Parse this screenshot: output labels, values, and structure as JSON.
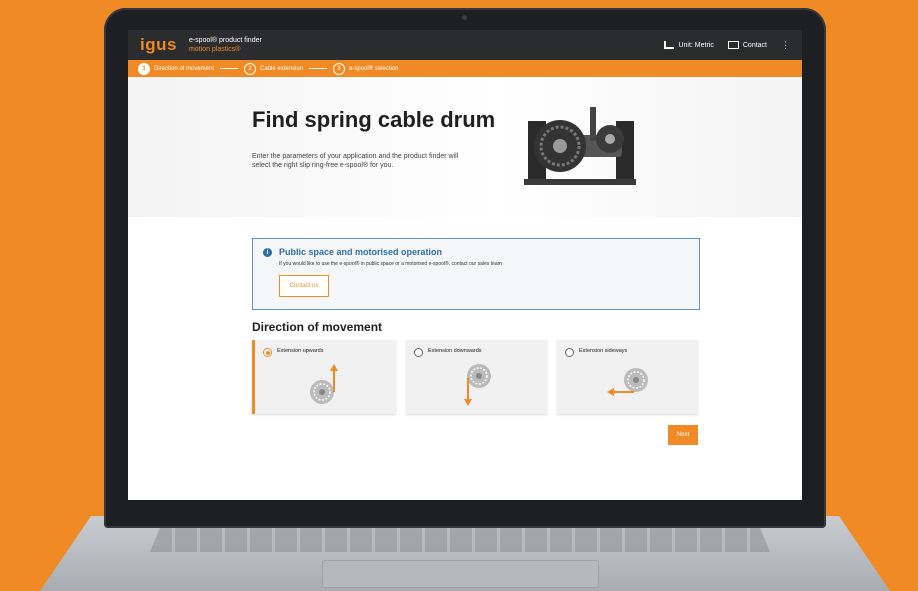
{
  "app": {
    "logo": "igus",
    "title": "e-spool® product finder",
    "subtitle": "motion plastics®"
  },
  "header": {
    "unit_label": "Unit: Metric",
    "contact_label": "Contact",
    "menu_icon": "more-vertical-icon"
  },
  "steps": [
    {
      "number": "1",
      "label": "Direction of movement",
      "active": true
    },
    {
      "number": "2",
      "label": "Cable extension",
      "active": false
    },
    {
      "number": "3",
      "label": "e-spool® selection",
      "active": false
    }
  ],
  "hero": {
    "title": "Find spring cable drum",
    "description": "Enter the parameters of your application and the product finder will select the right slip ring-free e-spool® for you."
  },
  "info": {
    "title": "Public space and motorised operation",
    "text": "If you would like to use the e-spool® in public space or a motorised e-spool®, contact our sales team",
    "button": "Contact us"
  },
  "direction": {
    "title": "Direction of movement",
    "options": [
      {
        "label": "Extension upwards",
        "selected": true
      },
      {
        "label": "Extension downwards",
        "selected": false
      },
      {
        "label": "Extension sideways",
        "selected": false
      }
    ]
  },
  "next_label": "Next",
  "colors": {
    "accent": "#f08a24",
    "info": "#2f6fa8",
    "dark": "#2b2c2e"
  }
}
